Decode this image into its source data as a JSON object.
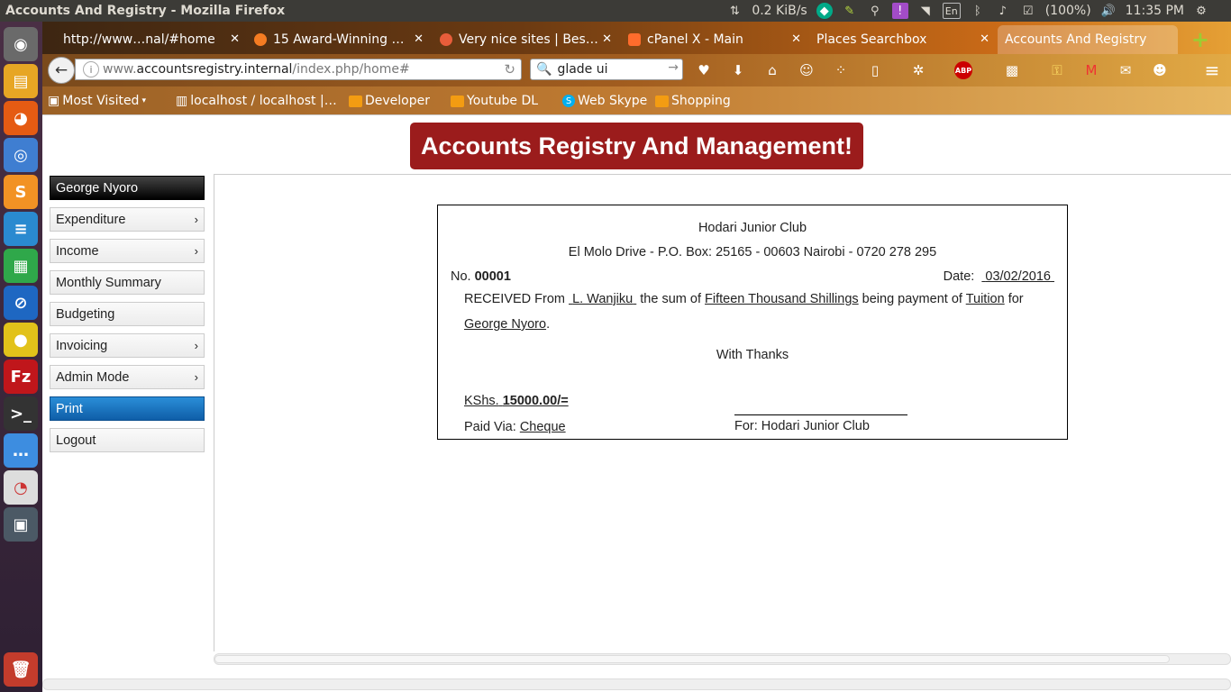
{
  "window_title": "Accounts And Registry - Mozilla Firefox",
  "system_tray": {
    "network_speed": "0.2 KiB/s",
    "keyboard_layout": "En",
    "battery": "(100%)",
    "time": "11:35 PM"
  },
  "tabs": [
    {
      "label": "http://www…nal/#home",
      "icon_color": "#dddddd"
    },
    {
      "label": "15 Award-Winning …",
      "icon_color": "#f57c22"
    },
    {
      "label": "Very nice sites | Bes…",
      "icon_color": "#e85d3a"
    },
    {
      "label": "cPanel X - Main",
      "icon_color": "#ff6c2c"
    },
    {
      "label": "Places Searchbox",
      "icon_color": ""
    },
    {
      "label": "Accounts And Registry",
      "icon_color": ""
    }
  ],
  "url": {
    "prefix": "www.",
    "domain": "accountsregistry.internal",
    "path": "/index.php/home#"
  },
  "search": {
    "value": "glade ui"
  },
  "bookmarks": [
    {
      "label": "Most Visited"
    },
    {
      "label": "localhost / localhost |…"
    },
    {
      "label": "Developer"
    },
    {
      "label": "Youtube DL"
    },
    {
      "label": "Web Skype"
    },
    {
      "label": "Shopping"
    }
  ],
  "page": {
    "banner": "Accounts Registry And Management!",
    "sidebar": [
      {
        "label": "George Nyoro",
        "has_submenu": false
      },
      {
        "label": "Expenditure",
        "has_submenu": true
      },
      {
        "label": "Income",
        "has_submenu": true
      },
      {
        "label": "Monthly Summary",
        "has_submenu": false
      },
      {
        "label": "Budgeting",
        "has_submenu": false
      },
      {
        "label": "Invoicing",
        "has_submenu": true
      },
      {
        "label": "Admin Mode",
        "has_submenu": true
      },
      {
        "label": "Print",
        "has_submenu": false
      },
      {
        "label": "Logout",
        "has_submenu": false
      }
    ],
    "chevron": "›",
    "receipt": {
      "org_name": "Hodari Junior Club",
      "address": "El Molo Drive - P.O. Box: 25165 - 00603 Nairobi - 0720 278 295",
      "no_label": "No.",
      "number": "00001",
      "date_label": "Date:",
      "date": "03/02/2016",
      "received_from_label": "RECEIVED From",
      "payer": "L. Wanjiku",
      "sum_label": "the sum of",
      "amount_words": "Fifteen Thousand Shillings",
      "payment_label": "being payment of",
      "purpose": "Tuition",
      "for_label": "for",
      "student": "George Nyoro",
      "period": ".",
      "thanks": "With Thanks",
      "currency_label": "KShs.",
      "amount": "15000.00/=",
      "paid_via_label": "Paid Via:",
      "paid_via": "Cheque",
      "signature_label": "For: Hodari Junior Club"
    }
  },
  "colors": {
    "banner_bg": "#9b1c1c",
    "menu_active": "#1a76c4",
    "menu_user": "#111111"
  }
}
